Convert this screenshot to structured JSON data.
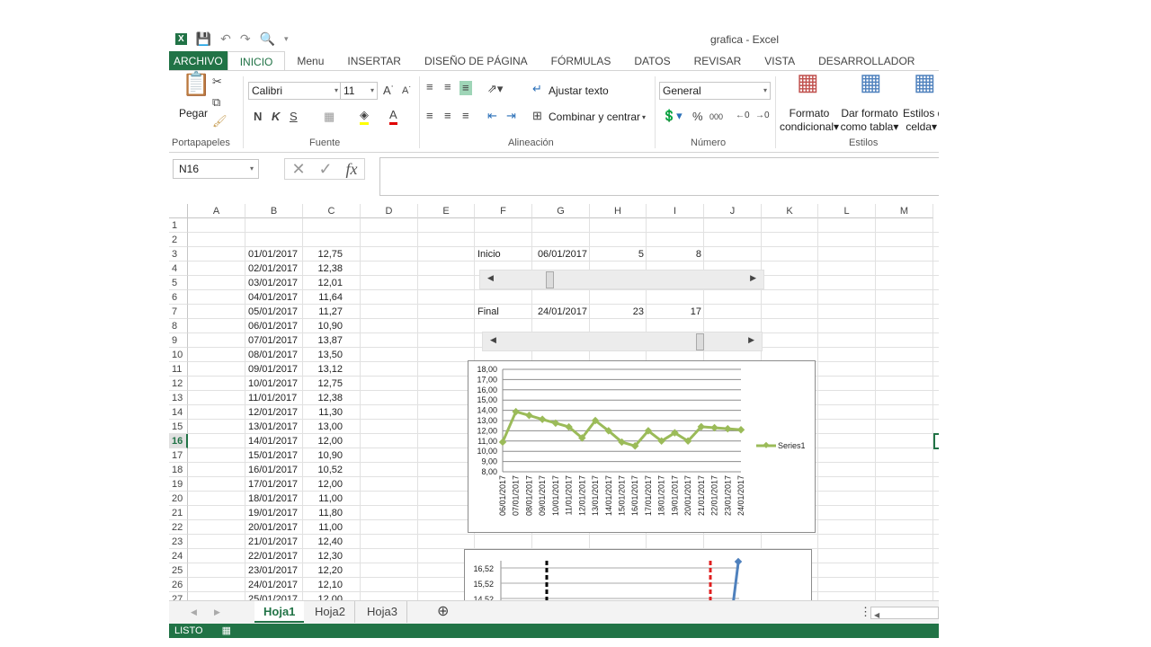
{
  "window": {
    "title": "grafica - Excel"
  },
  "ribbon_tabs": [
    "ARCHIVO",
    "INICIO",
    "Menu",
    "INSERTAR",
    "DISEÑO DE PÁGINA",
    "FÓRMULAS",
    "DATOS",
    "REVISAR",
    "VISTA",
    "DESARROLLADOR"
  ],
  "active_tab": "INICIO",
  "ribbon": {
    "paste_label": "Pegar",
    "font_name": "Calibri",
    "font_size": "11",
    "bold": "N",
    "italic": "K",
    "underline": "S",
    "wrap_text": "Ajustar texto",
    "merge_center": "Combinar y centrar",
    "number_format": "General",
    "percent": "%",
    "thousands": "000",
    "cond_format_1": "Formato",
    "cond_format_2": "condicional",
    "table_format_1": "Dar formato",
    "table_format_2": "como tabla",
    "cell_styles_1": "Estilos de",
    "cell_styles_2": "celda",
    "groups": [
      "Portapapeles",
      "Fuente",
      "Alineación",
      "Número",
      "Estilos"
    ]
  },
  "formula_bar": {
    "name_box": "N16",
    "fx": "fx",
    "value": ""
  },
  "columns": [
    "A",
    "B",
    "C",
    "D",
    "E",
    "F",
    "G",
    "H",
    "I",
    "J",
    "K",
    "L",
    "M"
  ],
  "rows": [
    "1",
    "2",
    "3",
    "4",
    "5",
    "6",
    "7",
    "8",
    "9",
    "10",
    "11",
    "12",
    "13",
    "14",
    "15",
    "16",
    "17",
    "18",
    "19",
    "20",
    "21",
    "22",
    "23",
    "24",
    "25",
    "26",
    "27"
  ],
  "data_table": {
    "dates": [
      "01/01/2017",
      "02/01/2017",
      "03/01/2017",
      "04/01/2017",
      "05/01/2017",
      "06/01/2017",
      "07/01/2017",
      "08/01/2017",
      "09/01/2017",
      "10/01/2017",
      "11/01/2017",
      "12/01/2017",
      "13/01/2017",
      "14/01/2017",
      "15/01/2017",
      "16/01/2017",
      "17/01/2017",
      "18/01/2017",
      "19/01/2017",
      "20/01/2017",
      "21/01/2017",
      "22/01/2017",
      "23/01/2017",
      "24/01/2017",
      "25/01/2017"
    ],
    "values": [
      "12,75",
      "12,38",
      "12,01",
      "11,64",
      "11,27",
      "10,90",
      "13,87",
      "13,50",
      "13,12",
      "12,75",
      "12,38",
      "11,30",
      "13,00",
      "12,00",
      "10,90",
      "10,52",
      "12,00",
      "11,00",
      "11,80",
      "11,00",
      "12,40",
      "12,30",
      "12,20",
      "12,10",
      "12,00"
    ]
  },
  "controls": {
    "inicio": {
      "label": "Inicio",
      "date": "06/01/2017",
      "h": "5",
      "i": "8",
      "scroll_fraction": 0.2
    },
    "final": {
      "label": "Final",
      "date": "24/01/2017",
      "h": "23",
      "i": "17",
      "scroll_fraction": 0.83
    }
  },
  "chart_data": [
    {
      "type": "line",
      "categories": [
        "06/01/2017",
        "07/01/2017",
        "08/01/2017",
        "09/01/2017",
        "10/01/2017",
        "11/01/2017",
        "12/01/2017",
        "13/01/2017",
        "14/01/2017",
        "15/01/2017",
        "16/01/2017",
        "17/01/2017",
        "18/01/2017",
        "19/01/2017",
        "20/01/2017",
        "21/01/2017",
        "22/01/2017",
        "23/01/2017",
        "24/01/2017"
      ],
      "series": [
        {
          "name": "Series1",
          "values": [
            10.9,
            13.87,
            13.5,
            13.12,
            12.75,
            12.38,
            11.3,
            13.0,
            12.0,
            10.9,
            10.52,
            12.0,
            11.0,
            11.8,
            11.0,
            12.4,
            12.3,
            12.2,
            12.1
          ],
          "color": "#9bbb59"
        }
      ],
      "yticks": [
        "8,00",
        "9,00",
        "10,00",
        "11,00",
        "12,00",
        "13,00",
        "14,00",
        "15,00",
        "16,00",
        "17,00",
        "18,00"
      ],
      "ylim": [
        8,
        18
      ],
      "grid": true,
      "legend": "right"
    },
    {
      "type": "line",
      "yticks": [
        "16,52",
        "15,52",
        "14,52"
      ],
      "markers": [
        {
          "color": "#000000",
          "style": "dashed"
        },
        {
          "color": "#e02020",
          "style": "dashed"
        }
      ],
      "series_color": "#4f81bd"
    }
  ],
  "sheets": [
    "Hoja1",
    "Hoja2",
    "Hoja3"
  ],
  "active_sheet": "Hoja1",
  "status": {
    "text": "LISTO"
  },
  "colors": {
    "excel_green": "#217346",
    "series": "#9bbb59"
  }
}
